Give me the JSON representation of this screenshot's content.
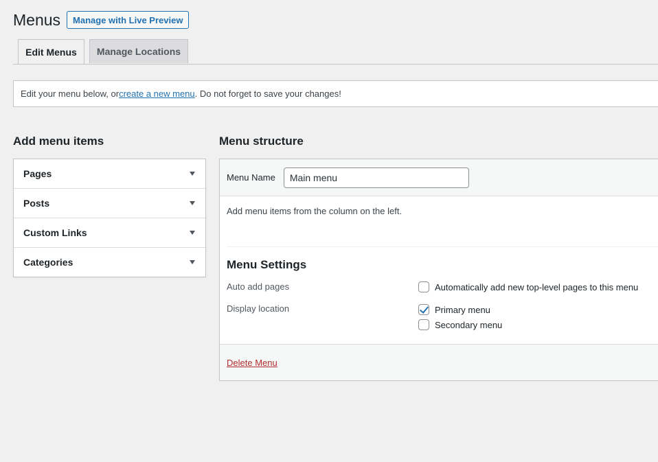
{
  "header": {
    "title": "Menus",
    "live_preview_label": "Manage with Live Preview"
  },
  "tabs": [
    {
      "label": "Edit Menus",
      "active": true
    },
    {
      "label": "Manage Locations",
      "active": false
    }
  ],
  "notice": {
    "prefix": "Edit your menu below, or ",
    "link_text": "create a new menu",
    "suffix": ". Do not forget to save your changes!"
  },
  "add_items": {
    "heading": "Add menu items",
    "sections": [
      {
        "label": "Pages",
        "icon": "chevron-down-icon"
      },
      {
        "label": "Posts",
        "icon": "chevron-down-icon"
      },
      {
        "label": "Custom Links",
        "icon": "chevron-down-icon"
      },
      {
        "label": "Categories",
        "icon": "chevron-down-icon"
      }
    ]
  },
  "structure": {
    "heading": "Menu structure",
    "menu_name_label": "Menu Name",
    "menu_name_value": "Main menu",
    "instructions": "Add menu items from the column on the left.",
    "settings_title": "Menu Settings",
    "auto_add_label": "Auto add pages",
    "auto_add_option": "Automatically add new top-level pages to this menu",
    "auto_add_checked": false,
    "display_location_label": "Display location",
    "locations": [
      {
        "label": "Primary menu",
        "checked": true
      },
      {
        "label": "Secondary menu",
        "checked": false
      }
    ],
    "delete_label": "Delete Menu"
  },
  "colors": {
    "accent": "#2271b1",
    "danger": "#b32d2e",
    "background": "#f0f0f1"
  }
}
